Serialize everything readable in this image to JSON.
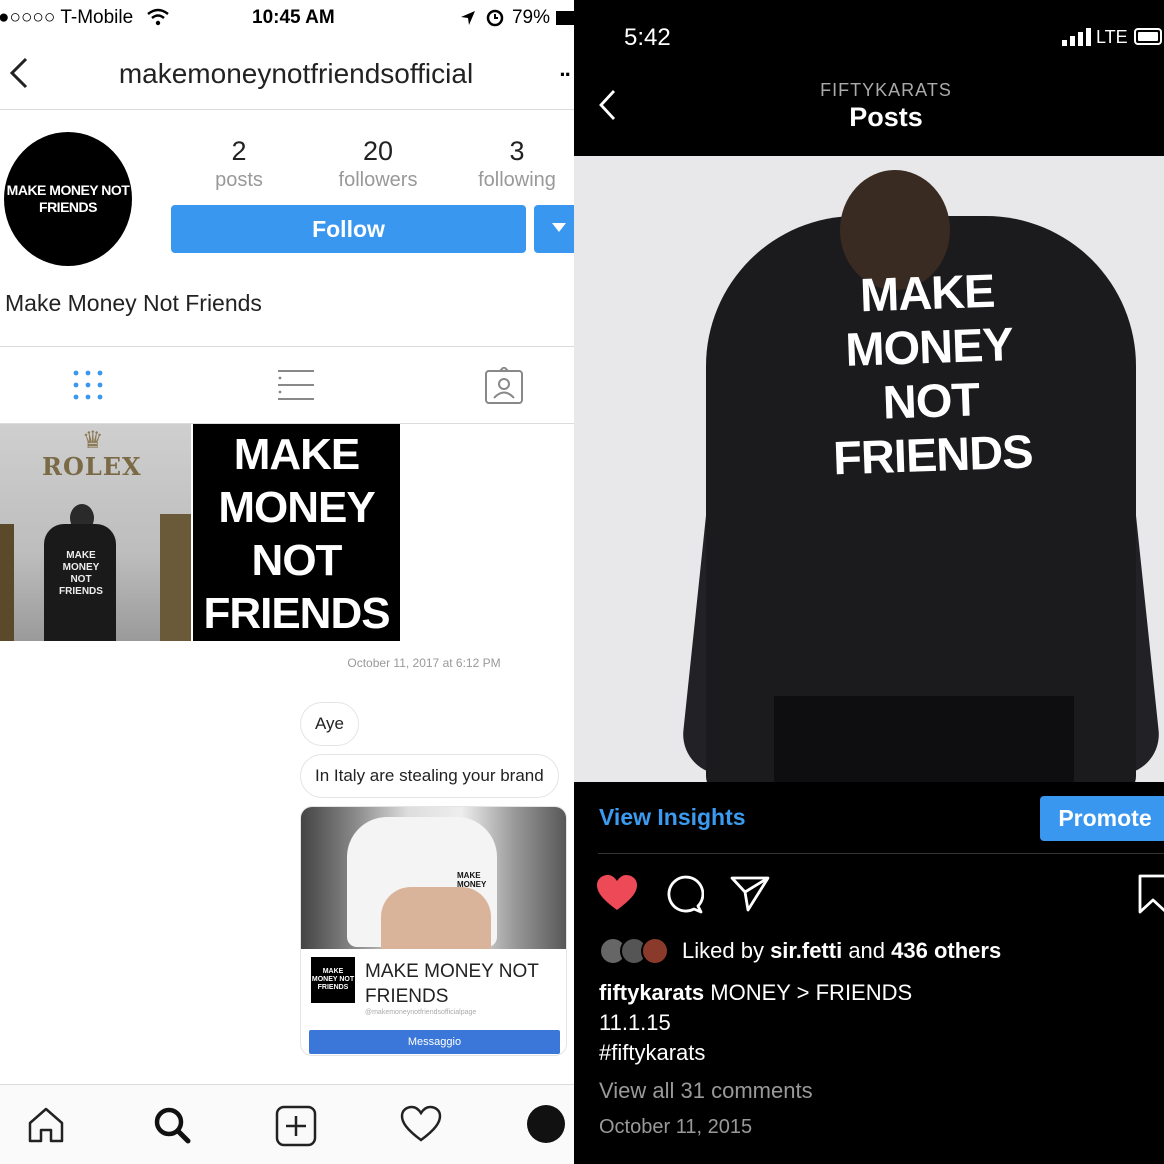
{
  "left_phone": {
    "status_bar": {
      "carrier": "●○○○○ T-Mobile",
      "time": "10:45 AM",
      "battery": "79%"
    },
    "header": {
      "username": "makemoneynotfriendsofficial",
      "more": "··"
    },
    "avatar_text": "MAKE MONEY NOT FRIENDS",
    "stats": [
      {
        "num": "2",
        "label": "posts"
      },
      {
        "num": "20",
        "label": "followers"
      },
      {
        "num": "3",
        "label": "following"
      }
    ],
    "follow_label": "Follow",
    "profile_name": "Make Money Not Friends",
    "grid": {
      "post1_brand": "ROLEX",
      "post1_shirt": "MAKE MONEY NOT FRIENDS",
      "post2_lines": [
        "MAKE",
        "MONEY",
        "NOT",
        "FRIENDS"
      ]
    },
    "dm": {
      "timestamp": "October 11, 2017 at 6:12 PM",
      "messages": [
        "Aye",
        "In Italy are stealing your brand"
      ],
      "shared_card": {
        "shirt_text": "MAKE MONEY",
        "logo_text": "MAKE MONEY NOT FRIENDS",
        "name": "MAKE MONEY NOT FRIENDS",
        "url": "@makemoneynotfriendsofficialpage",
        "button": "Messaggio"
      }
    },
    "bottom_nav": [
      "home-icon",
      "search-icon",
      "add-icon",
      "heart-icon",
      "profile-avatar"
    ]
  },
  "right_phone": {
    "status_bar": {
      "time": "5:42",
      "network": "LTE"
    },
    "header": {
      "account": "FIFTYKARATS",
      "title": "Posts"
    },
    "photo_text": [
      "MAKE",
      "MONEY",
      "NOT",
      "FRIENDS"
    ],
    "insights_label": "View Insights",
    "promote_label": "Promote",
    "liked_by": {
      "prefix": "Liked by ",
      "user": "sir.fetti",
      "middle": " and ",
      "others": "436 others"
    },
    "caption": {
      "user": "fiftykarats",
      "text": " MONEY > FRIENDS",
      "line2": "11.1.15",
      "line3": "#fiftykarats"
    },
    "view_comments": "View all 31 comments",
    "date": "October 11, 2015",
    "colors": {
      "like": "#ed4956",
      "link": "#3b9bf0",
      "button": "#3a97f0"
    }
  }
}
